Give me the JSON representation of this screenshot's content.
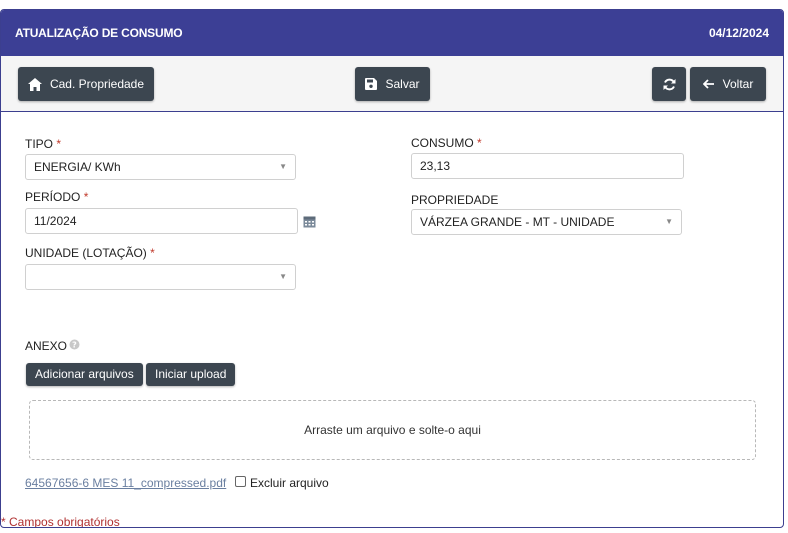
{
  "header": {
    "title": "ATUALIZAÇÃO DE CONSUMO",
    "date": "04/12/2024"
  },
  "toolbar": {
    "cad_propriedade_label": "Cad. Propriedade",
    "salvar_label": "Salvar",
    "voltar_label": "Voltar"
  },
  "form": {
    "tipo": {
      "label": "TIPO",
      "required": "*",
      "value": "ENERGIA/ KWh"
    },
    "consumo": {
      "label": "CONSUMO",
      "required": "*",
      "value": "23,13"
    },
    "periodo": {
      "label": "PERÍODO",
      "required": "*",
      "value": "11/2024"
    },
    "propriedade": {
      "label": "PROPRIEDADE",
      "value": "VÁRZEA GRANDE - MT - UNIDADE"
    },
    "unidade": {
      "label": "UNIDADE (LOTAÇÃO)",
      "required": "*",
      "value": ""
    }
  },
  "anexo": {
    "label": "ANEXO",
    "add_files_label": "Adicionar arquivos",
    "start_upload_label": "Iniciar upload",
    "dropzone_text": "Arraste um arquivo e solte-o aqui",
    "file_name": "64567656-6 MES 11_compressed.pdf",
    "delete_label": "Excluir arquivo"
  },
  "footer": {
    "required_note": "* Campos obrigatórios"
  },
  "icons": {
    "home": "home-icon",
    "save": "floppy-icon",
    "refresh": "refresh-icon",
    "back": "arrow-left-icon",
    "calendar": "calendar-icon",
    "help": "question-circle-icon"
  },
  "colors": {
    "header_bg": "#3c3f95",
    "button_bg": "#3c4650",
    "required": "#c0392b"
  }
}
